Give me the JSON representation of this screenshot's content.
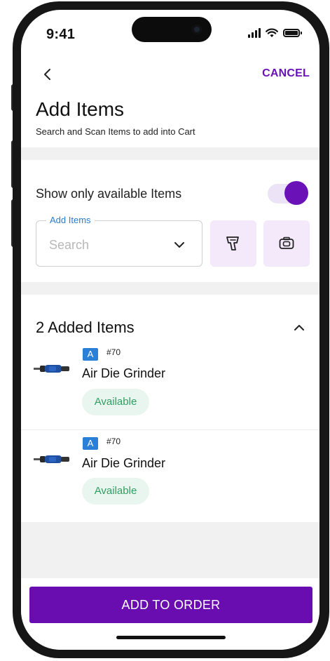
{
  "status_bar": {
    "time": "9:41"
  },
  "nav": {
    "back_icon": "chevron-left-icon",
    "cancel_label": "CANCEL"
  },
  "header": {
    "title": "Add Items",
    "subtitle": "Search and Scan Items to add into Cart"
  },
  "filters": {
    "available_only_label": "Show only available Items",
    "available_only_on": true
  },
  "search": {
    "label": "Add Items",
    "placeholder": "Search",
    "dropdown_icon": "chevron-down-icon",
    "scan_icon": "barcode-scanner-icon",
    "camera_icon": "camera-icon"
  },
  "added": {
    "title": "2 Added Items",
    "collapse_icon": "chevron-up-icon",
    "items": [
      {
        "badge": "A",
        "sku": "#70",
        "name": "Air Die Grinder",
        "status": "Available"
      },
      {
        "badge": "A",
        "sku": "#70",
        "name": "Air Die Grinder",
        "status": "Available"
      }
    ]
  },
  "footer": {
    "order_label": "ADD TO ORDER"
  },
  "colors": {
    "accent": "#6a12b8",
    "accent_light": "#f3e9fb",
    "badge_blue": "#2a7fd6",
    "available_green": "#2f9e62",
    "available_bg": "#e9f6ef",
    "field_label_blue": "#2e7cc7"
  }
}
